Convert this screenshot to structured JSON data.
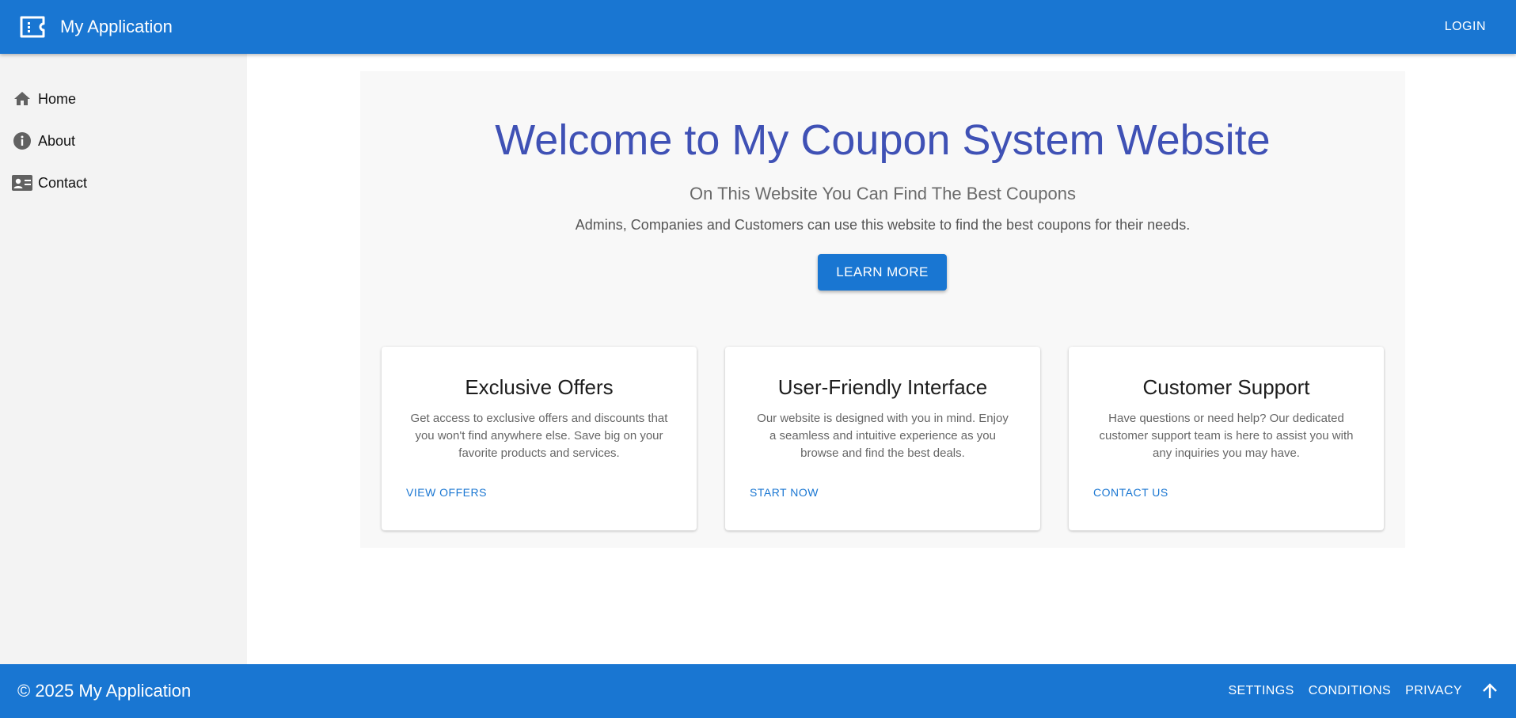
{
  "header": {
    "logo_icon": "coupon-icon",
    "title": "My Application",
    "login_label": "LOGIN",
    "color": "#1976d2"
  },
  "sidebar": {
    "items": [
      {
        "label": "Home",
        "icon": "home-icon"
      },
      {
        "label": "About",
        "icon": "info-icon"
      },
      {
        "label": "Contact",
        "icon": "contact-card-icon"
      }
    ]
  },
  "hero": {
    "title": "Welcome to My Coupon System Website",
    "subtitle": "On This Website You Can Find The Best Coupons",
    "description": "Admins, Companies and Customers can use this website to find the best coupons for their needs.",
    "button_label": "LEARN MORE",
    "title_color": "#3f51b5"
  },
  "cards": [
    {
      "title": "Exclusive Offers",
      "text": "Get access to exclusive offers and discounts that you won't find anywhere else. Save big on your favorite products and services.",
      "action": "VIEW OFFERS"
    },
    {
      "title": "User-Friendly Interface",
      "text": "Our website is designed with you in mind. Enjoy a seamless and intuitive experience as you browse and find the best deals.",
      "action": "START NOW"
    },
    {
      "title": "Customer Support",
      "text": "Have questions or need help? Our dedicated customer support team is here to assist you with any inquiries you may have.",
      "action": "CONTACT US"
    }
  ],
  "footer": {
    "copyright": "© 2025 My Application",
    "links": [
      "SETTINGS",
      "CONDITIONS",
      "PRIVACY"
    ],
    "scroll_top_icon": "arrow-up-icon"
  }
}
